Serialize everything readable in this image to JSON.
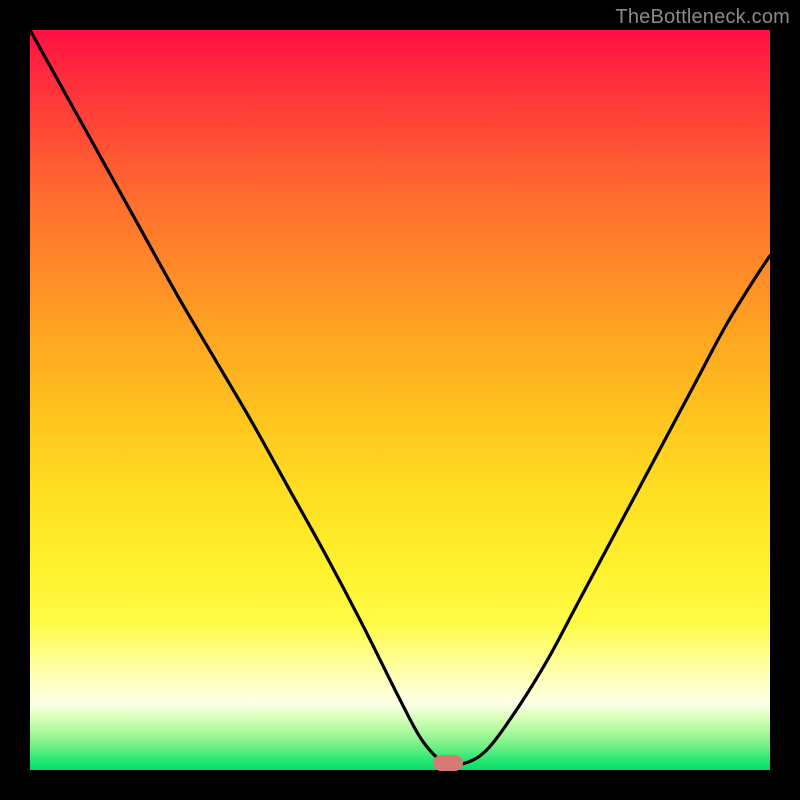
{
  "watermark": "TheBottleneck.com",
  "marker": {
    "x_fraction": 0.565,
    "y_fraction": 0.99
  },
  "colors": {
    "curve": "#000000",
    "marker": "#d77a73",
    "frame": "#000000"
  },
  "chart_data": {
    "type": "line",
    "title": "",
    "xlabel": "",
    "ylabel": "",
    "xlim": [
      0,
      1
    ],
    "ylim": [
      0,
      1
    ],
    "series": [
      {
        "name": "bottleneck-curve",
        "x": [
          0.0,
          0.05,
          0.1,
          0.15,
          0.2,
          0.25,
          0.3,
          0.35,
          0.4,
          0.45,
          0.5,
          0.53,
          0.56,
          0.59,
          0.62,
          0.66,
          0.7,
          0.74,
          0.78,
          0.82,
          0.86,
          0.9,
          0.94,
          0.98,
          1.0
        ],
        "y": [
          1.0,
          0.91,
          0.82,
          0.73,
          0.64,
          0.555,
          0.47,
          0.38,
          0.29,
          0.195,
          0.095,
          0.04,
          0.01,
          0.01,
          0.03,
          0.085,
          0.15,
          0.225,
          0.3,
          0.375,
          0.45,
          0.525,
          0.6,
          0.665,
          0.695
        ]
      }
    ],
    "annotations": [
      {
        "type": "marker",
        "x": 0.565,
        "y": 0.01,
        "label": ""
      }
    ]
  }
}
